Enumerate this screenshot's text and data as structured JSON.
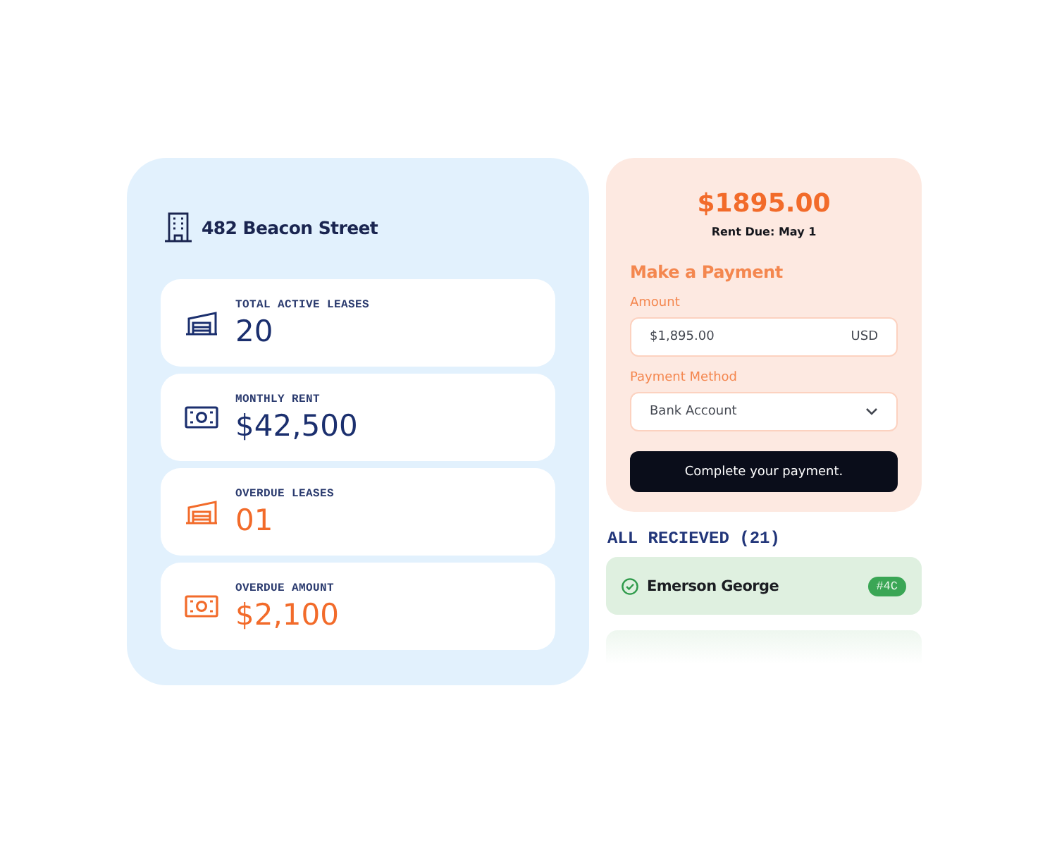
{
  "property": {
    "name": "482 Beacon Street"
  },
  "stats": [
    {
      "kind": "lease",
      "label": "TOTAL ACTIVE LEASES",
      "value": "20",
      "color": "#1b2f6e"
    },
    {
      "kind": "money",
      "label": "MONTHLY RENT",
      "value": "$42,500",
      "color": "#1b2f6e"
    },
    {
      "kind": "lease",
      "label": "OVERDUE LEASES",
      "value": "01",
      "color": "#f26b2a"
    },
    {
      "kind": "money",
      "label": "OVERDUE AMOUNT",
      "value": "$2,100",
      "color": "#f26b2a"
    }
  ],
  "payment": {
    "amount_due": "$1895.00",
    "due": "Rent Due: May 1",
    "title": "Make a Payment",
    "fields": [
      {
        "kind": "input",
        "label": "Amount",
        "value": "$1,895.00",
        "suffix": "USD"
      },
      {
        "kind": "select",
        "label": "Payment Method",
        "value": "Bank Account"
      }
    ],
    "button": "Complete your payment."
  },
  "received": {
    "title": "ALL RECIEVED (21)",
    "items": [
      {
        "name": "Emerson George",
        "badge": "#4C",
        "checked": true
      }
    ]
  }
}
